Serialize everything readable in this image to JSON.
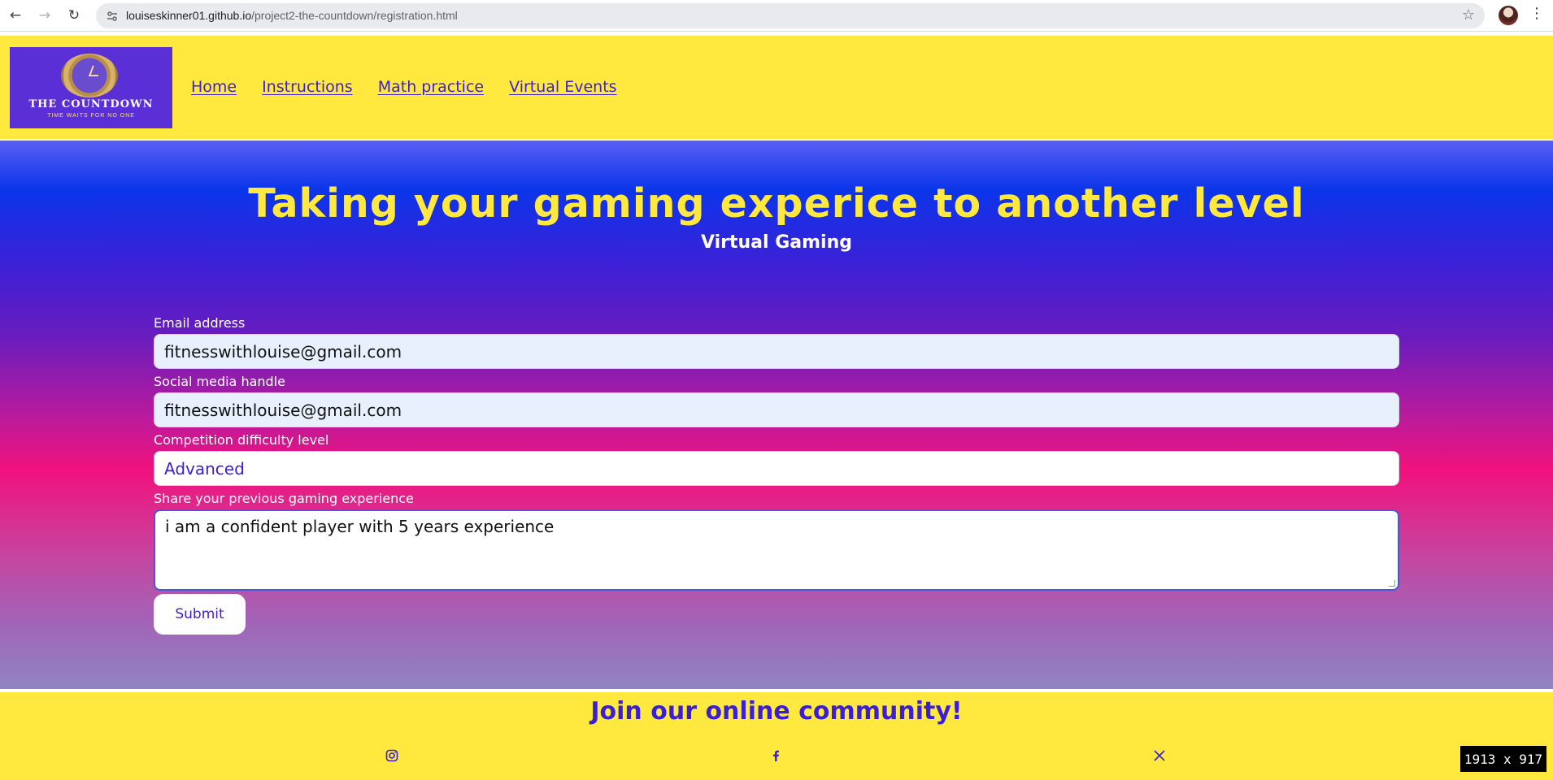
{
  "browser": {
    "url_host": "louiseskinner01.github.io",
    "url_path": "/project2-the-countdown/registration.html",
    "back_icon": "arrow-left-icon",
    "forward_icon": "arrow-right-icon",
    "reload_icon": "reload-icon",
    "bookmark_icon": "star-icon"
  },
  "header": {
    "logo_title": "THE COUNTDOWN",
    "logo_tagline": "TIME WAITS FOR NO ONE",
    "nav": [
      "Home",
      "Instructions",
      "Math practice",
      "Virtual Events"
    ]
  },
  "hero": {
    "title": "Taking your gaming experice to another level",
    "subtitle": "Virtual Gaming"
  },
  "form": {
    "email_label": "Email address",
    "email_value": "fitnesswithlouise@gmail.com",
    "social_label": "Social media handle",
    "social_value": "fitnesswithlouise@gmail.com",
    "difficulty_label": "Competition difficulty level",
    "difficulty_value": "Advanced",
    "experience_label": "Share your previous gaming experience",
    "experience_value": "i am a confident player with 5 years experience",
    "submit_label": "Submit"
  },
  "footer": {
    "title": "Join our online community!",
    "social_icons": [
      "instagram-icon",
      "facebook-icon",
      "x-twitter-icon"
    ]
  },
  "overlay": {
    "dimensions": "1913 x 917"
  },
  "colors": {
    "header_bg": "#ffe93f",
    "accent_yellow": "#ffe93f",
    "link_blue": "#3a1fd6",
    "gradient_top": "#0b35ea",
    "gradient_mid": "#f1117d"
  }
}
